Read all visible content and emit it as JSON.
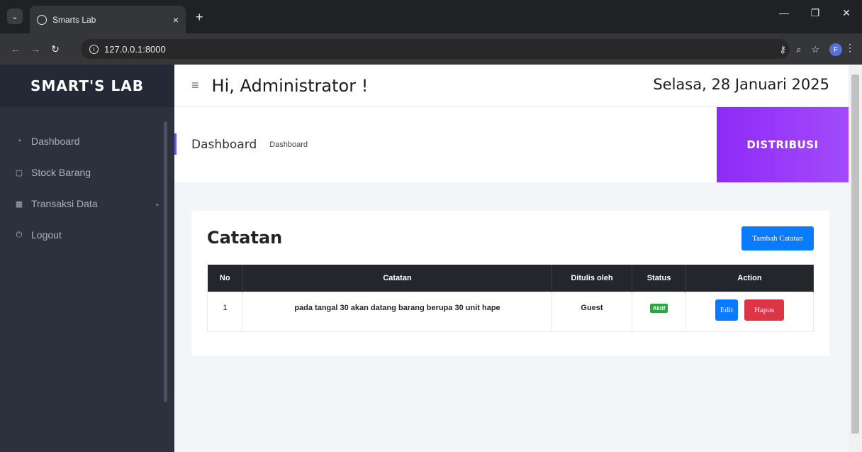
{
  "browser": {
    "tab_title": "Smarts Lab",
    "tab_close": "×",
    "new_tab": "+",
    "url": "127.0.0.1:8000",
    "avatar_letter": "F"
  },
  "sidebar": {
    "brand": "SMART'S LAB",
    "items": [
      {
        "label": "Dashboard",
        "icon": "dashboard-icon"
      },
      {
        "label": "Stock Barang",
        "icon": "box-icon"
      },
      {
        "label": "Transaksi Data",
        "icon": "table-icon"
      },
      {
        "label": "Logout",
        "icon": "logout-icon"
      }
    ]
  },
  "topbar": {
    "greeting": "Hi, Administrator !",
    "date": "Selasa, 28 Januari 2025"
  },
  "header": {
    "title": "Dashboard",
    "breadcrumb": "Dashboard",
    "banner": "DISTRIBUSI"
  },
  "card": {
    "title": "Catatan",
    "add_button": "Tambah Catatan",
    "columns": [
      "No",
      "Catatan",
      "Ditulis oleh",
      "Status",
      "Action"
    ],
    "rows": [
      {
        "no": "1",
        "catatan": "pada tangal 30 akan datang barang berupa 30 unit hape",
        "author": "Guest",
        "status": "Aktif",
        "edit": "Edit",
        "delete": "Hapus"
      }
    ]
  },
  "colors": {
    "sidebar_bg": "#2b313d",
    "accent_purple": "#9b3bf9",
    "primary": "#0a7bff",
    "danger": "#dc3545",
    "success": "#28a745"
  }
}
